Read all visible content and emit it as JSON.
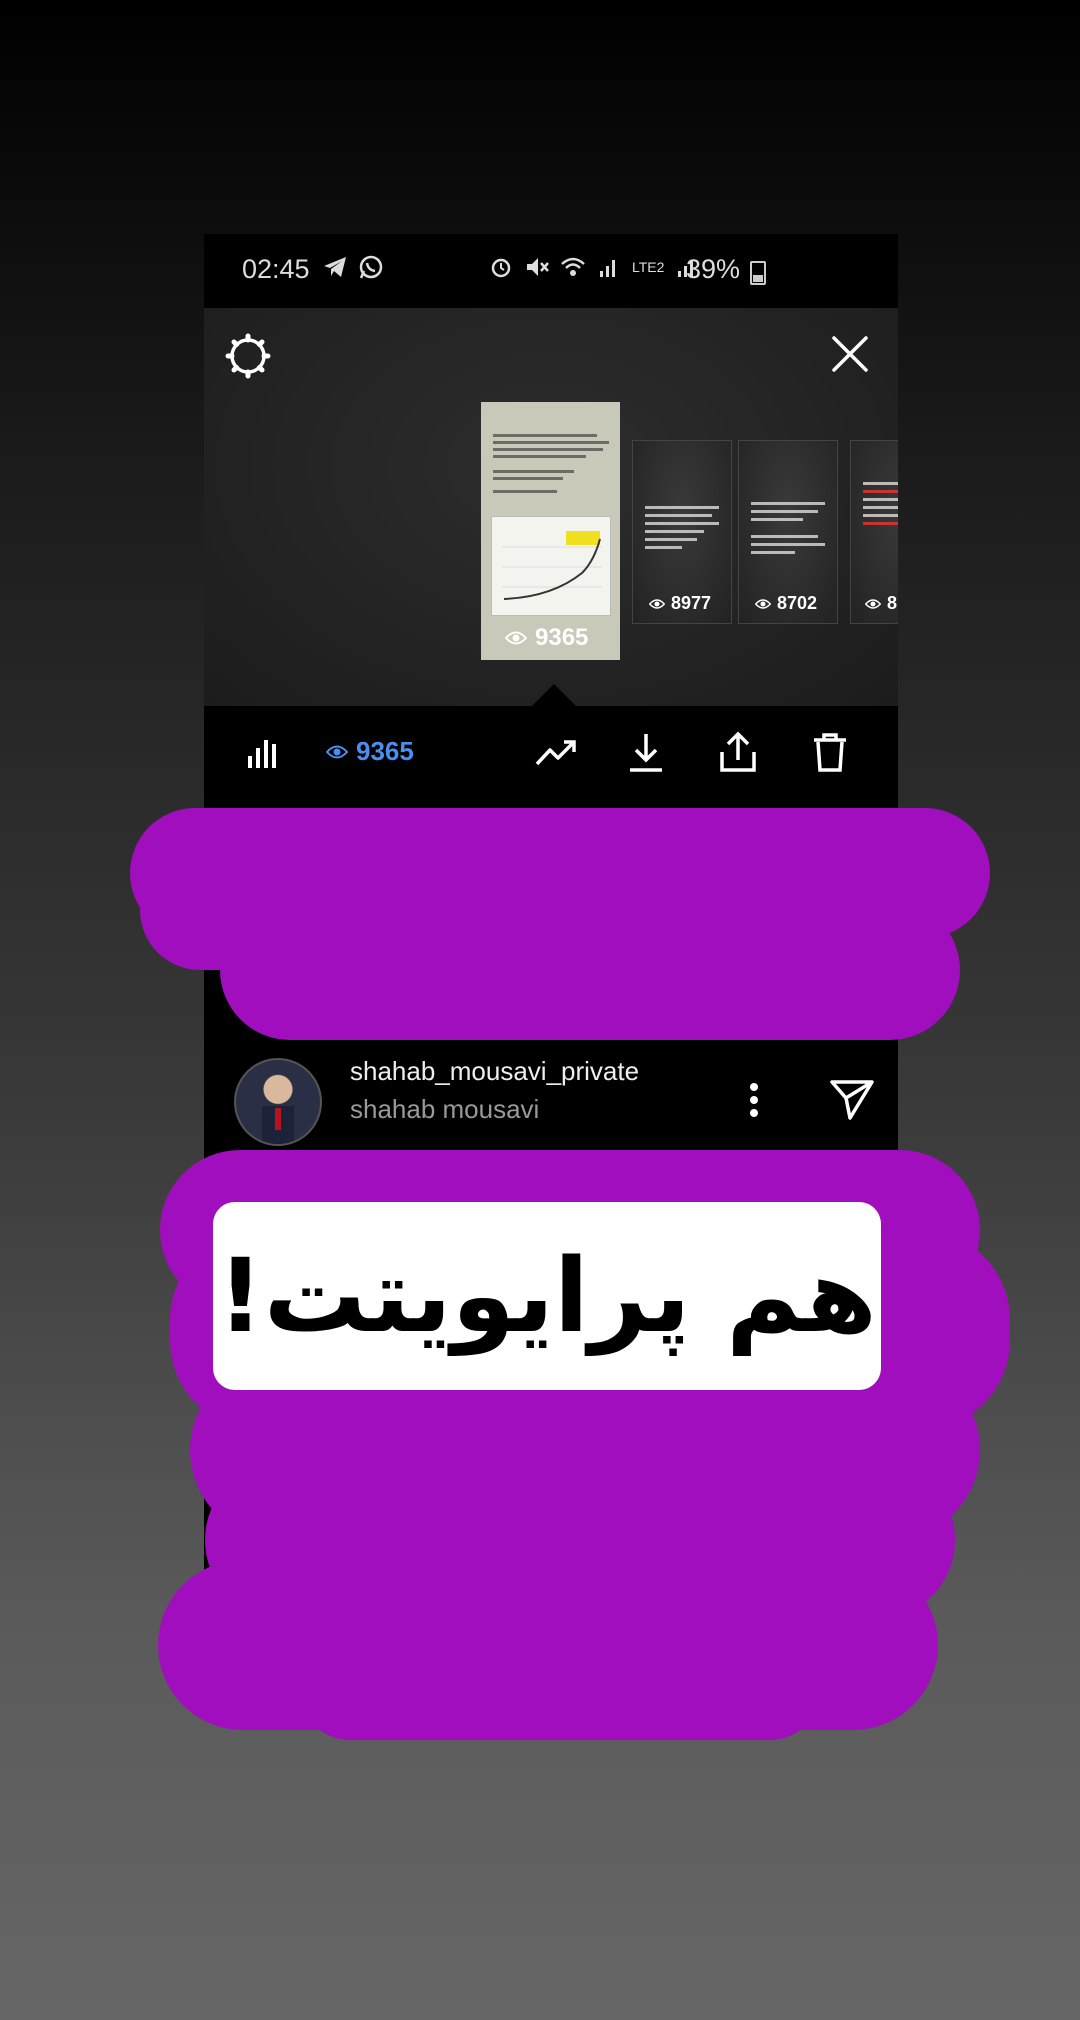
{
  "status_bar": {
    "time": "02:45",
    "left_icons": [
      "telegram-icon",
      "whatsapp-icon"
    ],
    "right_icons": [
      "alarm-icon",
      "mute-icon",
      "wifi-icon",
      "signal-icon",
      "volte-lte2-icon",
      "signal-icon"
    ],
    "network_label": "LTE2",
    "battery": "39%"
  },
  "story_viewer": {
    "settings_icon": "settings-gear-icon",
    "close_icon": "close-icon",
    "thumbnails": [
      {
        "views": "9365",
        "selected": true
      },
      {
        "views": "8977",
        "selected": false
      },
      {
        "views": "8702",
        "selected": false
      },
      {
        "views": "8",
        "selected": false
      }
    ]
  },
  "action_bar": {
    "stats_icon": "bar-chart-icon",
    "view_count": "9365",
    "actions": [
      "promote-icon",
      "download-icon",
      "share-icon",
      "delete-icon"
    ]
  },
  "profile": {
    "username": "shahab_mousavi_private",
    "full_name": "shahab mousavi"
  },
  "overlay": {
    "caption": "هم پرایویتت!",
    "scribble_color": "#a10ebd"
  }
}
